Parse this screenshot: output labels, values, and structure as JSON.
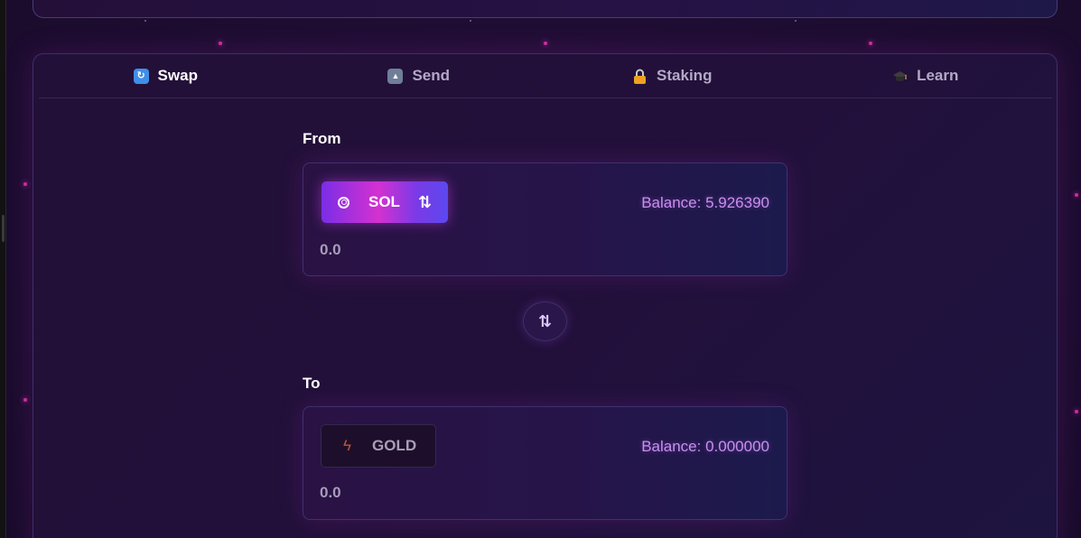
{
  "tabs": [
    {
      "label": "Swap",
      "icon": "swap-icon",
      "active": true
    },
    {
      "label": "Send",
      "icon": "outbox-icon",
      "active": false
    },
    {
      "label": "Staking",
      "icon": "lock-icon",
      "active": false
    },
    {
      "label": "Learn",
      "icon": "graduation-cap-icon",
      "active": false
    }
  ],
  "from": {
    "label": "From",
    "token": "SOL",
    "token_icon": "sol-coin-icon",
    "balance": "Balance: 5.926390",
    "amount_placeholder": "0.0"
  },
  "to": {
    "label": "To",
    "token": "GOLD",
    "token_icon": "lightning-icon",
    "balance": "Balance: 0.000000",
    "amount_placeholder": "0.0"
  },
  "flip_icon": "swap-vertical-icon",
  "colors": {
    "accent_gradient_start": "#7a2ee6",
    "accent_gradient_mid": "#d431d0",
    "accent_gradient_end": "#5c48f0",
    "balance_text": "#c98ff0",
    "particle": "#d12d9f"
  }
}
